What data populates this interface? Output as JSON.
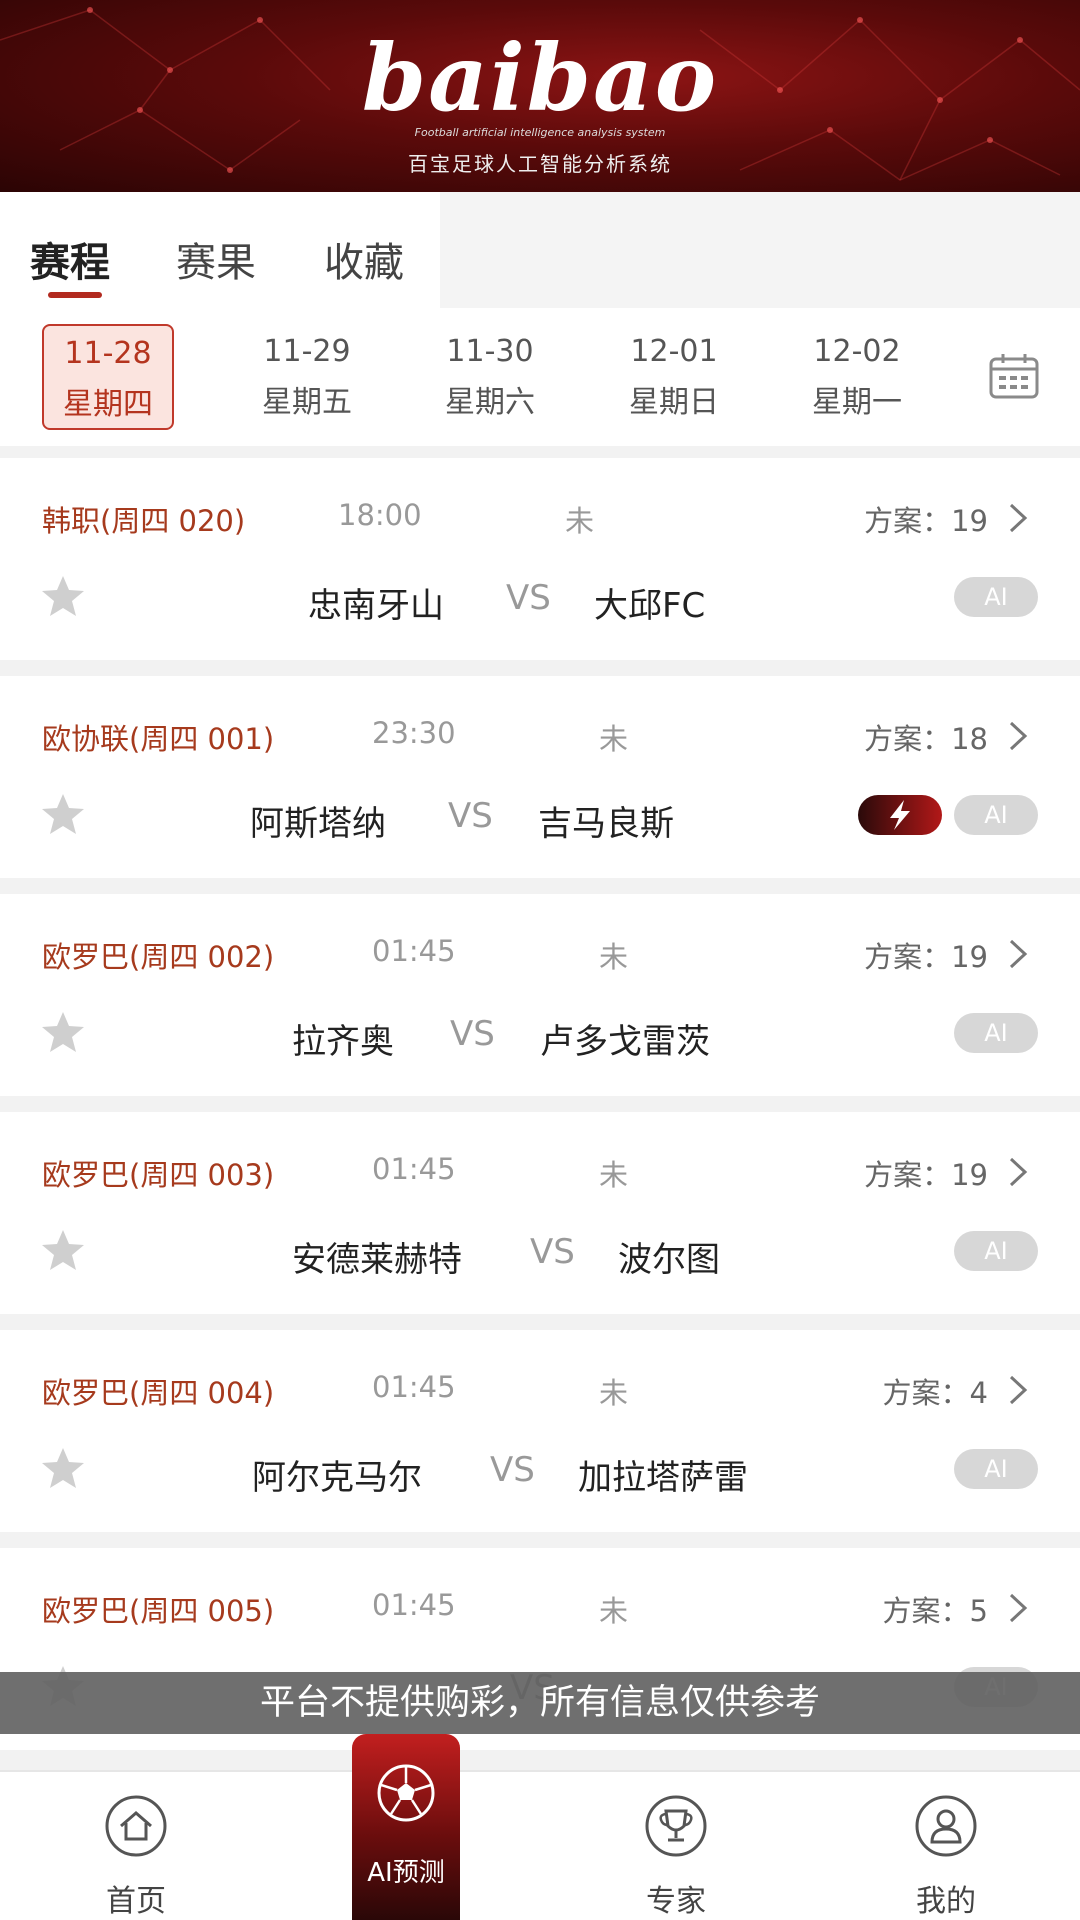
{
  "banner": {
    "logo": "baibao",
    "tagline": "Football artificial intelligence analysis system",
    "subtitle": "百宝足球人工智能分析系统"
  },
  "tabs": [
    "赛程",
    "赛果",
    "收藏"
  ],
  "active_tab": "赛程",
  "dates": [
    {
      "date": "11-28",
      "weekday": "星期四",
      "active": true
    },
    {
      "date": "11-29",
      "weekday": "星期五",
      "active": false
    },
    {
      "date": "11-30",
      "weekday": "星期六",
      "active": false
    },
    {
      "date": "12-01",
      "weekday": "星期日",
      "active": false
    },
    {
      "date": "12-02",
      "weekday": "星期一",
      "active": false
    }
  ],
  "matches": [
    {
      "league": "韩职(周四 020)",
      "time": "18:00",
      "status": "未",
      "plan": "方案：19",
      "home": "忠南牙山",
      "vs": "VS",
      "away": "大邱FC",
      "ai": "AI",
      "flash": false
    },
    {
      "league": "欧协联(周四 001)",
      "time": "23:30",
      "status": "未",
      "plan": "方案：18",
      "home": "阿斯塔纳",
      "vs": "VS",
      "away": "吉马良斯",
      "ai": "AI",
      "flash": true
    },
    {
      "league": "欧罗巴(周四 002)",
      "time": "01:45",
      "status": "未",
      "plan": "方案：19",
      "home": "拉齐奥",
      "vs": "VS",
      "away": "卢多戈雷茨",
      "ai": "AI",
      "flash": false
    },
    {
      "league": "欧罗巴(周四 003)",
      "time": "01:45",
      "status": "未",
      "plan": "方案：19",
      "home": "安德莱赫特",
      "vs": "VS",
      "away": "波尔图",
      "ai": "AI",
      "flash": false
    },
    {
      "league": "欧罗巴(周四 004)",
      "time": "01:45",
      "status": "未",
      "plan": "方案：4",
      "home": "阿尔克马尔",
      "vs": "VS",
      "away": "加拉塔萨雷",
      "ai": "AI",
      "flash": false
    },
    {
      "league": "欧罗巴(周四 005)",
      "time": "01:45",
      "status": "未",
      "plan": "方案：5",
      "home": "",
      "vs": "VS",
      "away": "",
      "ai": "AI",
      "flash": false
    }
  ],
  "notice": "平台不提供购彩，所有信息仅供参考",
  "nav": {
    "home": "首页",
    "ai": "AI预测",
    "expert": "专家",
    "mine": "我的"
  },
  "colors": {
    "accent": "#b22a1f",
    "league": "#a63a1d"
  }
}
